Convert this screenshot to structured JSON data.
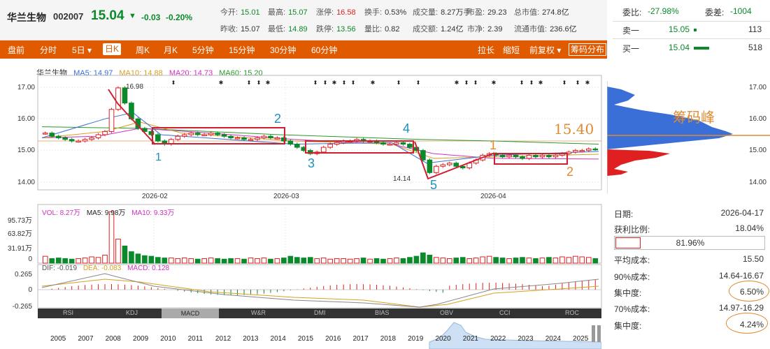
{
  "header": {
    "name": "华兰生物",
    "code": "002007",
    "price": "15.04",
    "arrow": "▼",
    "change": "-0.03",
    "change_pct": "-0.20%",
    "stats": [
      {
        "label": "今开:",
        "value": "15.01"
      },
      {
        "label": "最高:",
        "value": "15.07"
      },
      {
        "label": "涨停:",
        "value": "16.58"
      },
      {
        "label": "换手:",
        "value": "0.53%"
      },
      {
        "label": "成交量:",
        "value": "8.27万手"
      },
      {
        "label": "市盈:",
        "value": "29.23"
      },
      {
        "label": "总市值:",
        "value": "274.8亿"
      },
      {
        "label": "昨收:",
        "value": "15.07"
      },
      {
        "label": "最低:",
        "value": "14.89"
      },
      {
        "label": "跌停:",
        "value": "13.56"
      },
      {
        "label": "量比:",
        "value": "0.82"
      },
      {
        "label": "成交额:",
        "value": "1.24亿"
      },
      {
        "label": "市净:",
        "value": "2.39"
      },
      {
        "label": "流通市值:",
        "value": "236.6亿"
      }
    ]
  },
  "orderbook": {
    "weibi_label": "委比:",
    "weibi_value": "-27.98%",
    "weicha_label": "委差:",
    "weicha_value": "-1004",
    "sell1_label": "卖一",
    "sell1_price": "15.05",
    "sell1_qty": "113",
    "buy1_label": "买一",
    "buy1_price": "15.04",
    "buy1_qty": "518"
  },
  "toolbar": {
    "left": [
      "盘前",
      "分时",
      "5日 ▾",
      "日K",
      "周K",
      "月K",
      "5分钟",
      "15分钟",
      "30分钟",
      "60分钟"
    ],
    "selected": "日K",
    "right": [
      "拉长",
      "缩短",
      "前复权 ▾",
      "筹码分布"
    ]
  },
  "legend": {
    "name": "华兰生物",
    "ma5": "MA5: 14.97",
    "ma10": "MA10: 14.88",
    "ma20": "MA20: 14.73",
    "ma60": "MA60: 15.20"
  },
  "colors": {
    "ma5": "#3a6fd8",
    "ma10": "#d8a020",
    "ma20": "#d030c0",
    "ma60": "#2a9a2a",
    "up": "#e02020",
    "down": "#0a8a2a",
    "accent": "#e05a00"
  },
  "price_axis": [
    "17.00",
    "16.00",
    "15.00",
    "14.00"
  ],
  "date_axis": [
    "2026-02",
    "2026-03",
    "2026-04"
  ],
  "chip_axis": [
    "17.00",
    "16.00",
    "15.00",
    "14.00"
  ],
  "annotations": {
    "high": "16.98",
    "low": "14.14",
    "chip_peak": "筹码峰",
    "chip_price": "15.40",
    "marks": [
      "1",
      "2",
      "3",
      "4",
      "5",
      "1",
      "2"
    ]
  },
  "volume": {
    "vol": "VOL: 8.27万",
    "ma5": "MA5: 9.98万",
    "ma10": "MA10: 9.33万",
    "axis": [
      "95.73万",
      "63.82万",
      "31.91万",
      "0"
    ]
  },
  "macd": {
    "dif": "DIF: -0.019",
    "dea": "DEA: -0.083",
    "macd": "MACD: 0.128",
    "axis": [
      "0.265",
      "0",
      "-0.265"
    ]
  },
  "indicator_tabs": [
    "RSI",
    "KDJ",
    "MACD",
    "W&R",
    "DMI",
    "BIAS",
    "OBV",
    "CCI",
    "ROC"
  ],
  "indicator_selected": "MACD",
  "years": [
    "2005",
    "2007",
    "2008",
    "2009",
    "2010",
    "2011",
    "2012",
    "2013",
    "2014",
    "2015",
    "2016",
    "2017",
    "2018",
    "2019",
    "2020",
    "2021",
    "2022",
    "2023",
    "2024",
    "2025"
  ],
  "chip_stats": {
    "date_label": "日期:",
    "date": "2026-04-17",
    "profit_label": "获利比例:",
    "profit": "18.04%",
    "bar_value": "81.96%",
    "avg_label": "平均成本:",
    "avg": "15.50",
    "c90_label": "90%成本:",
    "c90": "14.64-16.67",
    "conc90_label": "集中度:",
    "conc90": "6.50%",
    "c70_label": "70%成本:",
    "c70": "14.97-16.29",
    "conc70_label": "集中度:",
    "conc70": "4.24%"
  }
}
